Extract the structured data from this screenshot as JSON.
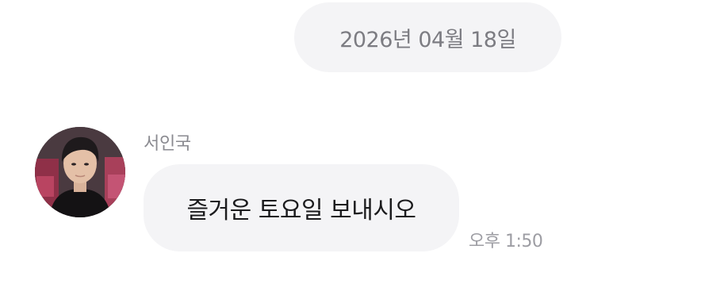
{
  "date_divider": {
    "label": "2026년 04월 18일"
  },
  "message": {
    "sender_name": "서인국",
    "text": "즐거운 토요일 보내시오",
    "time": "오후 1:50"
  },
  "colors": {
    "background": "#ffffff",
    "bubble_bg": "#f4f4f6",
    "date_text": "#7c7c82",
    "name_text": "#8a8a90",
    "message_text": "#1b1b1d",
    "time_text": "#9d9da3"
  }
}
